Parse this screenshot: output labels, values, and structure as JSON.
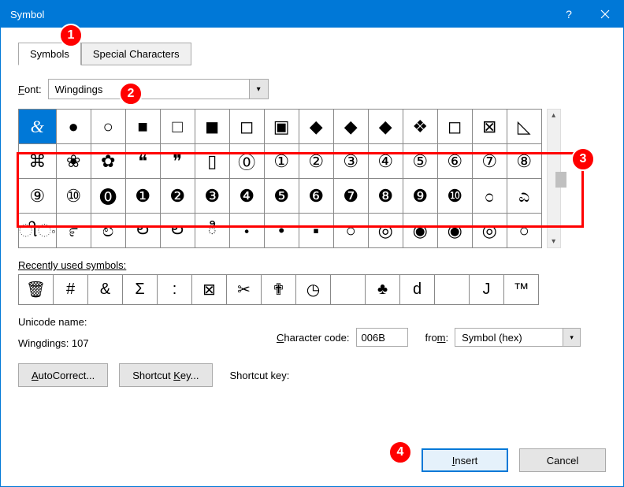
{
  "title": "Symbol",
  "tabs": {
    "symbols": "Symbols",
    "special": "Special Characters"
  },
  "font_label": "Font:",
  "font_value": "Wingdings",
  "grid": {
    "rows": [
      [
        "&",
        "●",
        "○",
        "■",
        "□",
        "◼",
        "◻",
        "▣",
        "◆",
        "◆",
        "◆",
        "❖",
        "◻",
        "⊠",
        "◺"
      ],
      [
        "⌘",
        "❀",
        "✿",
        "❝",
        "❞",
        "▯",
        "⓪",
        "①",
        "②",
        "③",
        "④",
        "⑤",
        "⑥",
        "⑦",
        "⑧"
      ],
      [
        "⑨",
        "⑩",
        "⓿",
        "❶",
        "❷",
        "❸",
        "❹",
        "❺",
        "❻",
        "❼",
        "❽",
        "❾",
        "❿",
        "೦",
        "ಎ"
      ],
      [
        "ીං",
        "೯",
        "ಲ",
        "ల",
        "ల",
        "ి",
        "・",
        "•",
        "▪",
        "○",
        "◎",
        "◉",
        "◉",
        "◎",
        "○"
      ]
    ],
    "selected": [
      0,
      0
    ]
  },
  "recent_label": "Recently used symbols:",
  "recent": [
    "🗑",
    "#",
    "&",
    "Σ",
    ":",
    "⊠",
    "✂",
    "✟",
    "◷",
    "",
    "♣",
    "d",
    "",
    "J",
    "™"
  ],
  "unicode_name_label": "Unicode name:",
  "unicode_name": "Wingdings: 107",
  "char_code_label": "Character code:",
  "char_code": "006B",
  "from_label": "from:",
  "from_value": "Symbol (hex)",
  "autocorrect": "AutoCorrect...",
  "shortcut_key": "Shortcut Key...",
  "shortcut_label": "Shortcut key:",
  "insert": "Insert",
  "cancel": "Cancel",
  "badges": {
    "b1": "1",
    "b2": "2",
    "b3": "3",
    "b4": "4"
  }
}
